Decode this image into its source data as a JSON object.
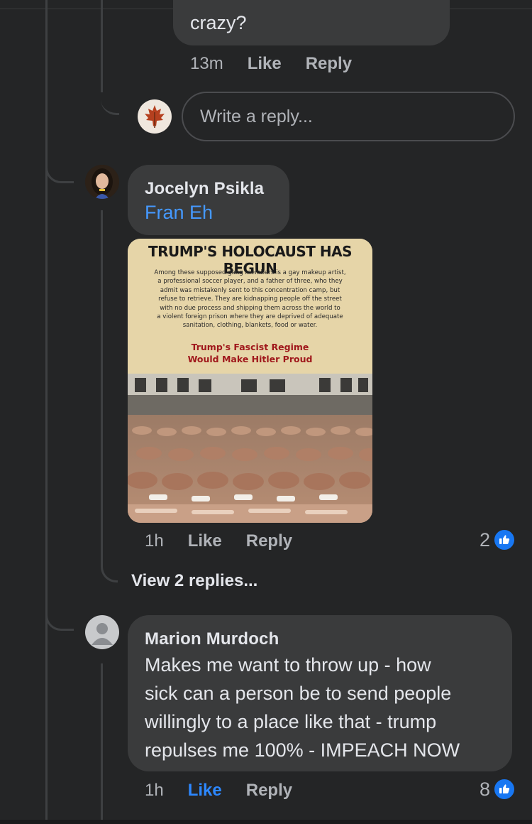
{
  "comments": [
    {
      "text": "crazy?",
      "time": "13m",
      "like_label": "Like",
      "reply_label": "Reply"
    },
    {
      "author": "Jocelyn Psikla",
      "mention": "Fran Eh",
      "time": "1h",
      "like_label": "Like",
      "reply_label": "Reply",
      "reaction_count": "2",
      "image": {
        "headline": "TRUMP'S HOLOCAUST HAS BEGUN",
        "body_lines": [
          "Among these supposed gang members is a gay makeup artist,",
          "a professional soccer player, and a father of three, who they",
          "admit was mistakenly sent to this concentration camp, but",
          "refuse to retrieve. They are kidnapping people off the street",
          "with no due process and shipping them across the world to",
          "a violent foreign prison where they are deprived of adequate",
          "sanitation, clothing, blankets, food or water."
        ],
        "red_line_1": "Trump's Fascist Regime",
        "red_line_2": "Would Make Hitler Proud"
      }
    },
    {
      "author": "Marion Murdoch",
      "text_lines": [
        "Makes me want to throw up - how",
        "sick can a person be to send people",
        "willingly to a place like that - trump",
        "repulses me 100% - IMPEACH NOW"
      ],
      "time": "1h",
      "like_label": "Like",
      "reply_label": "Reply",
      "reaction_count": "8"
    }
  ],
  "reply_box": {
    "placeholder": "Write a reply..."
  },
  "view_replies": "View 2 replies...",
  "colors": {
    "background": "#242526",
    "bubble": "#3a3b3c",
    "link_blue": "#4599ff",
    "like_blue": "#1877f2"
  },
  "icons": [
    "maple-leaf-avatar",
    "user-avatar",
    "default-avatar-icon",
    "like-thumb-icon"
  ]
}
